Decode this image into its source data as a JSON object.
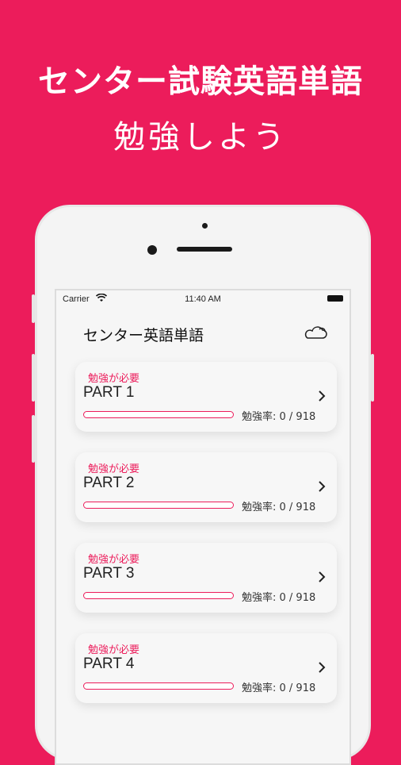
{
  "promo": {
    "title": "センター試験英語単語",
    "subtitle": "勉強しよう"
  },
  "status_bar": {
    "carrier": "Carrier",
    "time": "11:40 AM"
  },
  "app": {
    "title": "センター英語単語",
    "header_icon": "cloud-sun-icon"
  },
  "parts": [
    {
      "badge": "勉強が必要",
      "title": "PART 1",
      "progress_label": "勉強率: 0 / 918",
      "studied": 0,
      "total": 918
    },
    {
      "badge": "勉強が必要",
      "title": "PART 2",
      "progress_label": "勉強率: 0 / 918",
      "studied": 0,
      "total": 918
    },
    {
      "badge": "勉強が必要",
      "title": "PART 3",
      "progress_label": "勉強率: 0 / 918",
      "studied": 0,
      "total": 918
    },
    {
      "badge": "勉強が必要",
      "title": "PART 4",
      "progress_label": "勉強率: 0 / 918",
      "studied": 0,
      "total": 918
    }
  ],
  "colors": {
    "accent": "#ec1c5b",
    "card_background": "#f7f7f7"
  }
}
